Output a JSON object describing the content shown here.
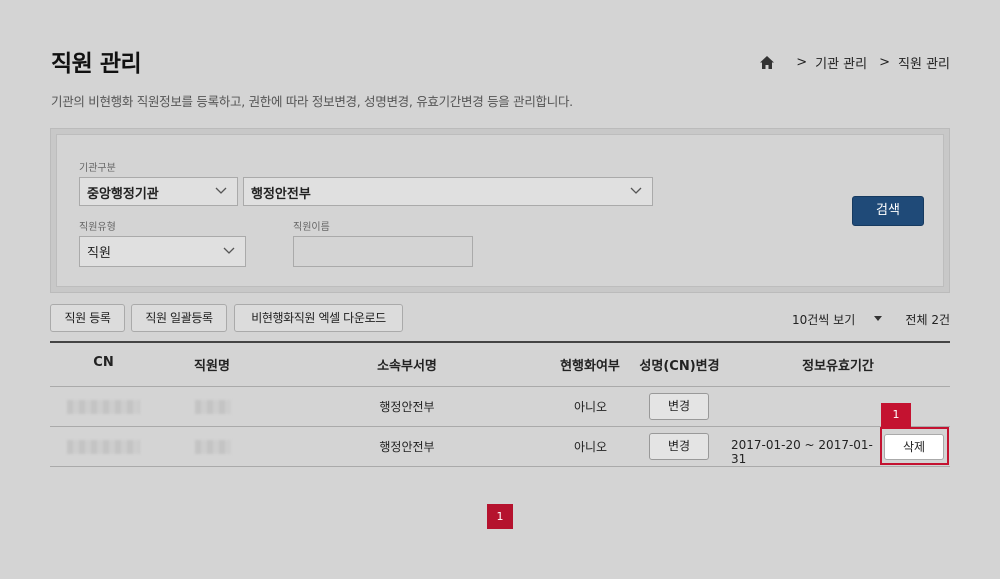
{
  "header": {
    "title": "직원 관리",
    "description": "기관의 비현행화 직원정보를 등록하고, 권한에 따라 정보변경, 성명변경, 유효기간변경 등을 관리합니다.",
    "breadcrumb": {
      "sep1": ">",
      "item1": "기관 관리",
      "sep2": ">",
      "item2": "직원 관리"
    }
  },
  "search": {
    "org_type_label": "기관구분",
    "org_type_value": "중앙행정기관",
    "org_name_value": "행정안전부",
    "staff_type_label": "직원유형",
    "staff_type_value": "직원",
    "staff_name_label": "직원이름",
    "staff_name_value": "",
    "search_button": "검색"
  },
  "toolbar": {
    "register": "직원 등록",
    "bulk_register": "직원 일괄등록",
    "excel_download": "비현행화직원 엑셀 다운로드",
    "page_size": "10건씩 보기",
    "total": "전체 2건"
  },
  "table": {
    "headers": [
      "CN",
      "직원명",
      "소속부서명",
      "현행화여부",
      "성명(CN)변경",
      "정보유효기간"
    ],
    "rows": [
      {
        "dept": "행정안전부",
        "current": "아니오",
        "change": "변경",
        "period": ""
      },
      {
        "dept": "행정안전부",
        "current": "아니오",
        "change": "변경",
        "period": "2017-01-20 ~ 2017-01-31",
        "delete": "삭제"
      }
    ]
  },
  "annotation": {
    "badge": "1"
  },
  "pagination": {
    "current": "1"
  }
}
